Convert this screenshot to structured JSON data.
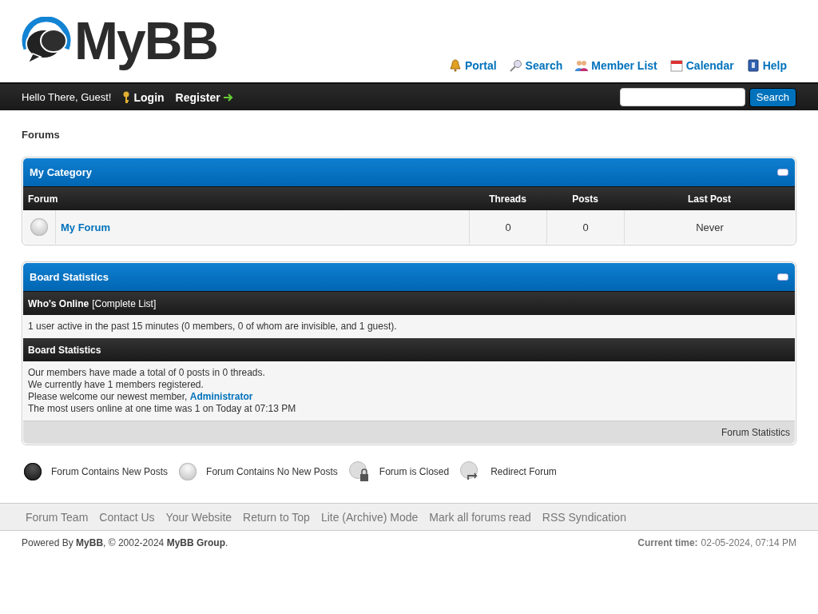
{
  "logo": {
    "text": "MyBB"
  },
  "top_links": [
    {
      "kind": "portal",
      "label": "Portal"
    },
    {
      "kind": "search",
      "label": "Search"
    },
    {
      "kind": "members",
      "label": "Member List"
    },
    {
      "kind": "calendar",
      "label": "Calendar"
    },
    {
      "kind": "help",
      "label": "Help"
    }
  ],
  "panel": {
    "welcome": "Hello There, Guest!",
    "login": "Login",
    "register": "Register",
    "search_button": "Search"
  },
  "breadcrumb": "Forums",
  "category": {
    "title": "My Category",
    "expanded": true,
    "columns": [
      "Forum",
      "Threads",
      "Posts",
      "Last Post"
    ],
    "forums": [
      {
        "name": "My Forum",
        "new_posts": false,
        "threads": "0",
        "posts": "0",
        "last_post": "Never"
      }
    ]
  },
  "stats": {
    "title": "Board Statistics",
    "expanded": true,
    "online_heading": "Who's Online",
    "online_link": "[Complete List]",
    "online_text": "1 user active in the past 15 minutes (0 members, 0 of whom are invisible, and 1 guest).",
    "stats_heading": "Board Statistics",
    "lines": [
      {
        "text": "Our members have made a total of 0 posts in 0 threads."
      },
      {
        "text": "We currently have 1 members registered."
      },
      {
        "text": "Please welcome our newest member, ",
        "link": "Administrator"
      },
      {
        "text": "The most users online at one time was 1 on Today at 07:13 PM"
      }
    ],
    "footer": "Forum Statistics"
  },
  "legend": [
    {
      "kind": "new",
      "label": "Forum Contains New Posts"
    },
    {
      "kind": "nonew",
      "label": "Forum Contains No New Posts"
    },
    {
      "kind": "closed",
      "label": "Forum is Closed"
    },
    {
      "kind": "redirect",
      "label": "Redirect Forum"
    }
  ],
  "footer_links": [
    "Forum Team",
    "Contact Us",
    "Your Website",
    "Return to Top",
    "Lite (Archive) Mode",
    "Mark all forums read",
    "RSS Syndication"
  ],
  "copyright": "Powered By **MyBB**, © 2002-2024 **MyBB Group**.",
  "current_time": {
    "label": "Current time:",
    "value": "02-05-2024, 07:14 PM"
  }
}
